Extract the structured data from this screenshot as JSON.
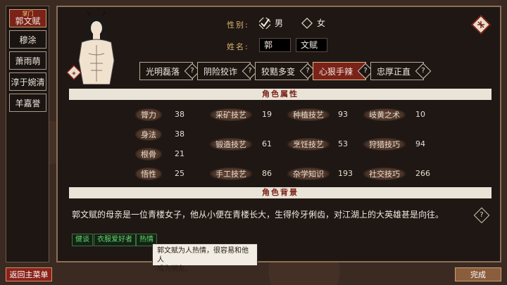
{
  "sidebar": {
    "items": [
      {
        "role": "掌门",
        "name": "郭文赋",
        "active": true
      },
      {
        "name": "穆涂"
      },
      {
        "name": "萧雨萌"
      },
      {
        "name": "淳于婉清"
      },
      {
        "name": "羊嘉誉"
      }
    ]
  },
  "form": {
    "gender_label": "性别:",
    "gender_options": [
      {
        "label": "男",
        "checked": true
      },
      {
        "label": "女",
        "checked": false
      }
    ],
    "name_label": "姓名:",
    "surname": "郭",
    "given_name": "文赋"
  },
  "traits": [
    {
      "label": "光明磊落",
      "help": "?"
    },
    {
      "label": "阴险狡诈",
      "help": "?"
    },
    {
      "label": "狡黠多变",
      "help": "?"
    },
    {
      "label": "心狠手辣",
      "help": "?",
      "active": true
    },
    {
      "label": "忠厚正直",
      "help": "?"
    }
  ],
  "attributes_title": "角色属性",
  "attributes": {
    "col1": [
      {
        "label": "膂力",
        "value": "38"
      },
      {
        "label": "身法",
        "value": "38"
      },
      {
        "label": "根骨",
        "value": "21"
      },
      {
        "label": "悟性",
        "value": "25"
      }
    ],
    "col2": [
      {
        "label": "采矿技艺",
        "value": "19"
      },
      {
        "label": "锻造技艺",
        "value": "61"
      },
      {
        "label": "手工技艺",
        "value": "86"
      }
    ],
    "col3": [
      {
        "label": "种植技艺",
        "value": "93"
      },
      {
        "label": "烹饪技艺",
        "value": "53"
      },
      {
        "label": "杂学知识",
        "value": "193"
      }
    ],
    "col4": [
      {
        "label": "岐黄之术",
        "value": "10"
      },
      {
        "label": "狩猎技巧",
        "value": "94"
      },
      {
        "label": "社交技巧",
        "value": "266"
      }
    ]
  },
  "background_title": "角色背景",
  "background_text": "郭文赋的母亲是一位青楼女子，他从小便在青楼长大，生得伶牙俐齿，对江湖上的大英雄甚是向往。",
  "help_glyph": "?",
  "tags": [
    "健谈",
    "衣服爱好者",
    "热情"
  ],
  "tooltip": {
    "line1": "郭文赋为人热情，很容易和他人",
    "line2": "成为朋友。"
  },
  "buttons": {
    "back": "返回主菜单",
    "done": "完成"
  },
  "colors": {
    "accent_red": "#7b2219",
    "tag_green": "#66d36a",
    "gold": "#d9b36f"
  }
}
